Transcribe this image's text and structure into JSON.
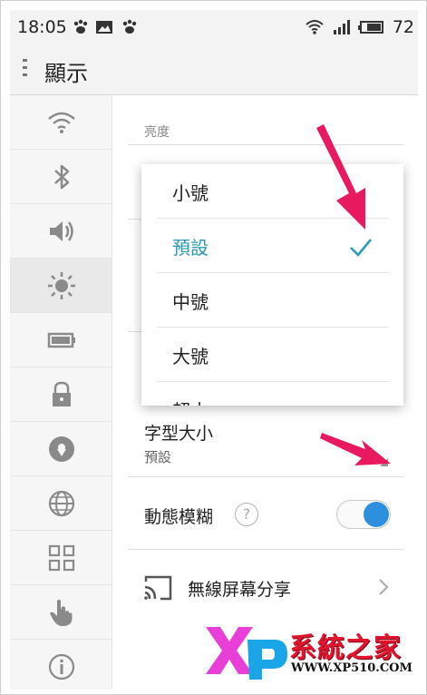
{
  "status_bar": {
    "time": "18:05",
    "battery_level": "72",
    "icons": [
      "paw-icon",
      "image-icon",
      "paw-icon",
      "wifi-icon",
      "signal-icon",
      "battery-icon"
    ]
  },
  "header": {
    "title": "顯示"
  },
  "sidebar": {
    "items": [
      {
        "icon": "wifi-icon"
      },
      {
        "icon": "bluetooth-icon"
      },
      {
        "icon": "volume-icon"
      },
      {
        "icon": "brightness-icon",
        "active": true
      },
      {
        "icon": "battery-icon"
      },
      {
        "icon": "lock-icon"
      },
      {
        "icon": "location-icon"
      },
      {
        "icon": "globe-icon"
      },
      {
        "icon": "grid-icon"
      },
      {
        "icon": "hand-pointer-icon"
      },
      {
        "icon": "info-icon"
      }
    ]
  },
  "main": {
    "brightness_section_label": "亮度",
    "font_size": {
      "title": "字型大小",
      "value": "預設"
    },
    "motion_blur": {
      "label": "動態模糊",
      "help": "?",
      "enabled": true
    },
    "wireless_display": {
      "label": "無線屏幕分享"
    }
  },
  "font_size_popup": {
    "options": [
      {
        "label": "小號",
        "selected": false
      },
      {
        "label": "預設",
        "selected": true
      },
      {
        "label": "中號",
        "selected": false
      },
      {
        "label": "大號",
        "selected": false
      },
      {
        "label": "超大",
        "selected": false
      }
    ]
  },
  "colors": {
    "accent": "#2b9ab0",
    "toggle_on": "#2f8fdf",
    "arrow": "#e8195f"
  },
  "watermark": {
    "logo_text": "XP",
    "site_name": "系統之家",
    "url": "WWW.XP510.COM"
  }
}
